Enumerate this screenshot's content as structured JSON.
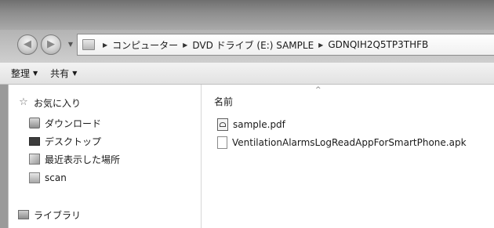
{
  "nav": {
    "back_glyph": "◀",
    "forward_glyph": "▶",
    "dropdown_glyph": "▼"
  },
  "address": {
    "separator": "▶",
    "segments": [
      "コンピューター",
      "DVD ドライブ (E:) SAMPLE",
      "GDNQIH2Q5TP3THFB"
    ]
  },
  "toolbar": {
    "organize_label": "整理",
    "share_label": "共有",
    "arrow": "▼"
  },
  "sidebar": {
    "favorites_label": "お気に入り",
    "items": [
      {
        "label": "ダウンロード",
        "icon": "download-folder-icon"
      },
      {
        "label": "デスクトップ",
        "icon": "desktop-icon"
      },
      {
        "label": "最近表示した場所",
        "icon": "recent-places-icon"
      },
      {
        "label": "scan",
        "icon": "folder-icon"
      }
    ],
    "libraries_label": "ライブラリ"
  },
  "content": {
    "column_name": "名前",
    "sort_caret": "^",
    "files": [
      {
        "name": "sample.pdf",
        "icon": "pdf-file-icon"
      },
      {
        "name": "VentilationAlarmsLogReadAppForSmartPhone.apk",
        "icon": "generic-file-icon"
      }
    ]
  }
}
